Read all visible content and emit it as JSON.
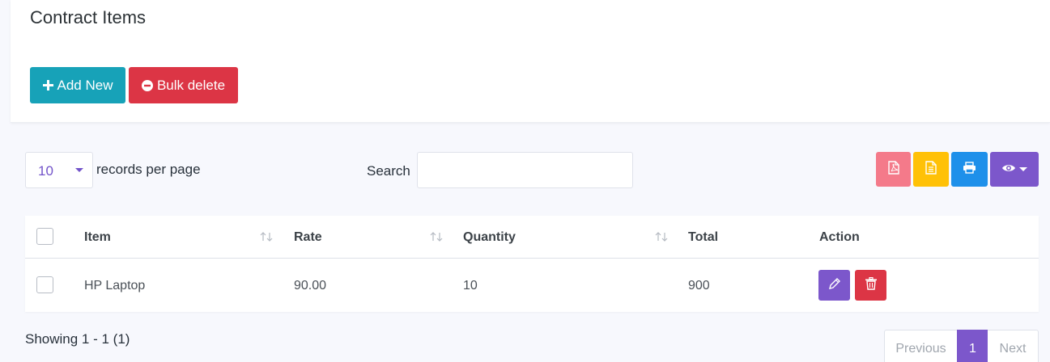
{
  "header": {
    "title": "Contract Items",
    "add_label": "Add New",
    "bulk_delete_label": "Bulk delete"
  },
  "controls": {
    "per_page_value": "10",
    "per_page_label": "records per page",
    "search_label": "Search",
    "search_value": ""
  },
  "toolbar": {
    "icons": [
      "pdf-icon",
      "csv-icon",
      "print-icon",
      "eye-icon"
    ]
  },
  "table": {
    "columns": [
      "Item",
      "Rate",
      "Quantity",
      "Total",
      "Action"
    ],
    "rows": [
      {
        "item": "HP Laptop",
        "rate": "90.00",
        "quantity": "10",
        "total": "900"
      }
    ]
  },
  "footer": {
    "showing": "Showing 1 - 1 (1)",
    "previous": "Previous",
    "current_page": "1",
    "next": "Next"
  },
  "colors": {
    "primary": "#7c57cb",
    "info": "#17a2b8",
    "danger": "#dc3545",
    "warning": "#ffc107",
    "pdf": "#f47a8a",
    "print": "#1e90ea"
  }
}
